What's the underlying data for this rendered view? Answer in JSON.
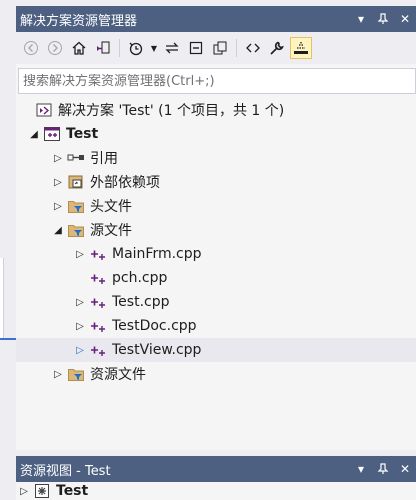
{
  "window": {
    "title": "解决方案资源管理器"
  },
  "search": {
    "placeholder": "搜索解决方案资源管理器(Ctrl+;)"
  },
  "tree": {
    "solution": "解决方案 'Test' (1 个项目，共 1 个)",
    "project": "Test",
    "references": "引用",
    "external": "外部依赖项",
    "headers": "头文件",
    "sources": "源文件",
    "files": [
      "MainFrm.cpp",
      "pch.cpp",
      "Test.cpp",
      "TestDoc.cpp",
      "TestView.cpp"
    ],
    "resources": "资源文件"
  },
  "resource_view": {
    "title": "资源视图 - Test",
    "item": "Test"
  },
  "colors": {
    "titlebar": "#4d6082",
    "accent": "#1e70c8",
    "folder": "#dcb67a",
    "vs_purple": "#68217a"
  }
}
